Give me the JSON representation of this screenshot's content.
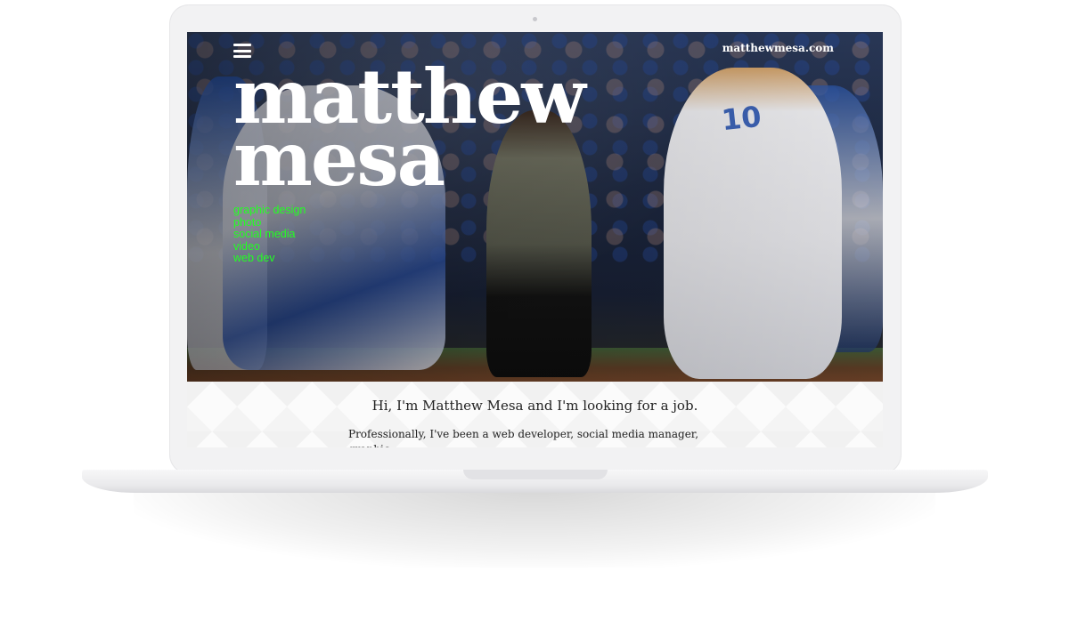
{
  "site": {
    "url": "matthewmesa.com",
    "brand_line1": "matthew",
    "brand_line2": "mesa"
  },
  "nav": {
    "items": [
      "graphic design",
      "photo",
      "social media",
      "video",
      "web dev"
    ]
  },
  "intro": {
    "heading": "Hi, I'm Matthew Mesa and I'm looking for a job.",
    "body": "Professionally, I've been a web developer, social media manager, graphic"
  },
  "hero": {
    "jersey_number": "10"
  },
  "icons": {
    "menu": "hamburger-menu-icon"
  },
  "colors": {
    "nav_accent": "#22ff22",
    "brand_text": "#ffffff"
  }
}
